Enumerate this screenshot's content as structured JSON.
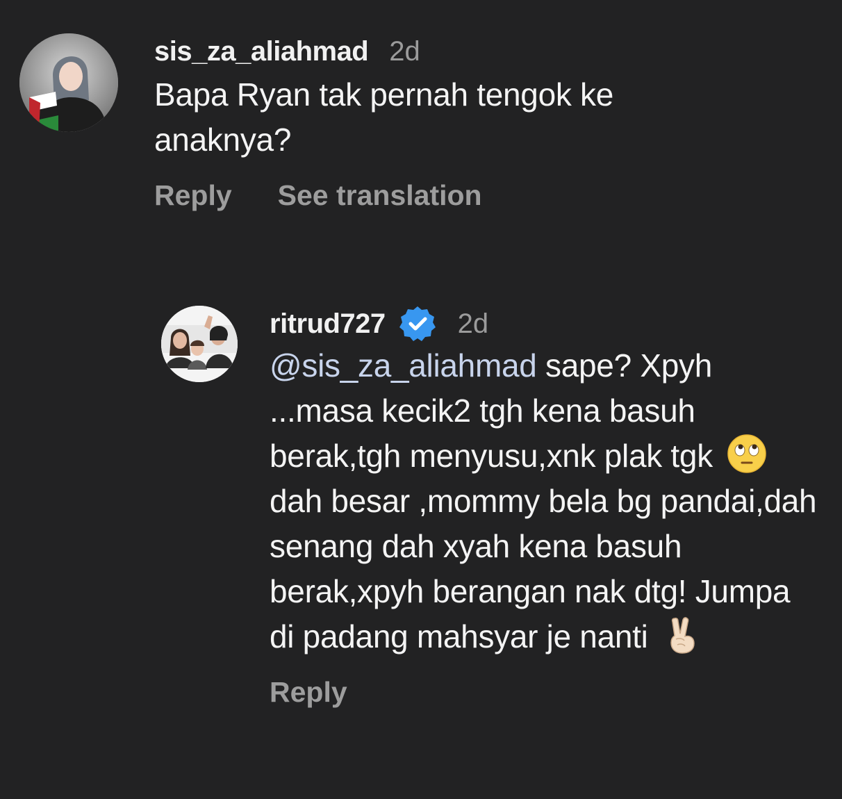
{
  "comments": [
    {
      "username": "sis_za_aliahmad",
      "time": "2d",
      "avatar_icon": "hijab-girl-avatar",
      "text": "Bapa Ryan tak pernah tengok ke anaknya?",
      "actions": {
        "reply": "Reply",
        "translate": "See translation"
      }
    },
    {
      "username": "ritrud727",
      "verified": true,
      "verified_icon": "verified-badge-icon",
      "verified_color": "#3897f0",
      "time": "2d",
      "avatar_icon": "family-photo-avatar",
      "mention": "@sis_za_aliahmad",
      "text_part1": " sape? Xpyh ...masa kecik2 tgh kena basuh berak,tgh menyusu,xnk plak tgk ",
      "emoji1": "face-with-rolling-eyes-emoji",
      "text_part2": " dah besar ,mommy bela bg pandai,dah senang dah xyah kena basuh berak,xpyh berangan nak dtg! Jumpa di padang mahsyar je nanti ",
      "emoji2": "victory-hand-emoji",
      "actions": {
        "reply": "Reply"
      }
    }
  ],
  "colors": {
    "background": "#222223",
    "username": "#f1f1f1",
    "muted": "#9b9b9b",
    "mention": "#c8d4ec"
  }
}
